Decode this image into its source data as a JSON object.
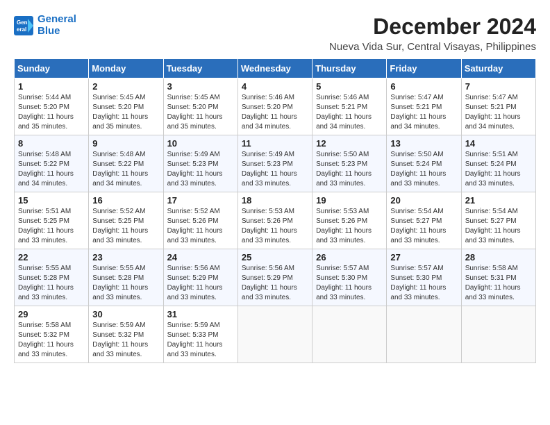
{
  "logo": {
    "line1": "General",
    "line2": "Blue"
  },
  "title": "December 2024",
  "subtitle": "Nueva Vida Sur, Central Visayas, Philippines",
  "weekdays": [
    "Sunday",
    "Monday",
    "Tuesday",
    "Wednesday",
    "Thursday",
    "Friday",
    "Saturday"
  ],
  "weeks": [
    [
      {
        "day": "1",
        "info": "Sunrise: 5:44 AM\nSunset: 5:20 PM\nDaylight: 11 hours\nand 35 minutes."
      },
      {
        "day": "2",
        "info": "Sunrise: 5:45 AM\nSunset: 5:20 PM\nDaylight: 11 hours\nand 35 minutes."
      },
      {
        "day": "3",
        "info": "Sunrise: 5:45 AM\nSunset: 5:20 PM\nDaylight: 11 hours\nand 35 minutes."
      },
      {
        "day": "4",
        "info": "Sunrise: 5:46 AM\nSunset: 5:20 PM\nDaylight: 11 hours\nand 34 minutes."
      },
      {
        "day": "5",
        "info": "Sunrise: 5:46 AM\nSunset: 5:21 PM\nDaylight: 11 hours\nand 34 minutes."
      },
      {
        "day": "6",
        "info": "Sunrise: 5:47 AM\nSunset: 5:21 PM\nDaylight: 11 hours\nand 34 minutes."
      },
      {
        "day": "7",
        "info": "Sunrise: 5:47 AM\nSunset: 5:21 PM\nDaylight: 11 hours\nand 34 minutes."
      }
    ],
    [
      {
        "day": "8",
        "info": "Sunrise: 5:48 AM\nSunset: 5:22 PM\nDaylight: 11 hours\nand 34 minutes."
      },
      {
        "day": "9",
        "info": "Sunrise: 5:48 AM\nSunset: 5:22 PM\nDaylight: 11 hours\nand 34 minutes."
      },
      {
        "day": "10",
        "info": "Sunrise: 5:49 AM\nSunset: 5:23 PM\nDaylight: 11 hours\nand 33 minutes."
      },
      {
        "day": "11",
        "info": "Sunrise: 5:49 AM\nSunset: 5:23 PM\nDaylight: 11 hours\nand 33 minutes."
      },
      {
        "day": "12",
        "info": "Sunrise: 5:50 AM\nSunset: 5:23 PM\nDaylight: 11 hours\nand 33 minutes."
      },
      {
        "day": "13",
        "info": "Sunrise: 5:50 AM\nSunset: 5:24 PM\nDaylight: 11 hours\nand 33 minutes."
      },
      {
        "day": "14",
        "info": "Sunrise: 5:51 AM\nSunset: 5:24 PM\nDaylight: 11 hours\nand 33 minutes."
      }
    ],
    [
      {
        "day": "15",
        "info": "Sunrise: 5:51 AM\nSunset: 5:25 PM\nDaylight: 11 hours\nand 33 minutes."
      },
      {
        "day": "16",
        "info": "Sunrise: 5:52 AM\nSunset: 5:25 PM\nDaylight: 11 hours\nand 33 minutes."
      },
      {
        "day": "17",
        "info": "Sunrise: 5:52 AM\nSunset: 5:26 PM\nDaylight: 11 hours\nand 33 minutes."
      },
      {
        "day": "18",
        "info": "Sunrise: 5:53 AM\nSunset: 5:26 PM\nDaylight: 11 hours\nand 33 minutes."
      },
      {
        "day": "19",
        "info": "Sunrise: 5:53 AM\nSunset: 5:26 PM\nDaylight: 11 hours\nand 33 minutes."
      },
      {
        "day": "20",
        "info": "Sunrise: 5:54 AM\nSunset: 5:27 PM\nDaylight: 11 hours\nand 33 minutes."
      },
      {
        "day": "21",
        "info": "Sunrise: 5:54 AM\nSunset: 5:27 PM\nDaylight: 11 hours\nand 33 minutes."
      }
    ],
    [
      {
        "day": "22",
        "info": "Sunrise: 5:55 AM\nSunset: 5:28 PM\nDaylight: 11 hours\nand 33 minutes."
      },
      {
        "day": "23",
        "info": "Sunrise: 5:55 AM\nSunset: 5:28 PM\nDaylight: 11 hours\nand 33 minutes."
      },
      {
        "day": "24",
        "info": "Sunrise: 5:56 AM\nSunset: 5:29 PM\nDaylight: 11 hours\nand 33 minutes."
      },
      {
        "day": "25",
        "info": "Sunrise: 5:56 AM\nSunset: 5:29 PM\nDaylight: 11 hours\nand 33 minutes."
      },
      {
        "day": "26",
        "info": "Sunrise: 5:57 AM\nSunset: 5:30 PM\nDaylight: 11 hours\nand 33 minutes."
      },
      {
        "day": "27",
        "info": "Sunrise: 5:57 AM\nSunset: 5:30 PM\nDaylight: 11 hours\nand 33 minutes."
      },
      {
        "day": "28",
        "info": "Sunrise: 5:58 AM\nSunset: 5:31 PM\nDaylight: 11 hours\nand 33 minutes."
      }
    ],
    [
      {
        "day": "29",
        "info": "Sunrise: 5:58 AM\nSunset: 5:32 PM\nDaylight: 11 hours\nand 33 minutes."
      },
      {
        "day": "30",
        "info": "Sunrise: 5:59 AM\nSunset: 5:32 PM\nDaylight: 11 hours\nand 33 minutes."
      },
      {
        "day": "31",
        "info": "Sunrise: 5:59 AM\nSunset: 5:33 PM\nDaylight: 11 hours\nand 33 minutes."
      },
      {
        "day": "",
        "info": ""
      },
      {
        "day": "",
        "info": ""
      },
      {
        "day": "",
        "info": ""
      },
      {
        "day": "",
        "info": ""
      }
    ]
  ]
}
